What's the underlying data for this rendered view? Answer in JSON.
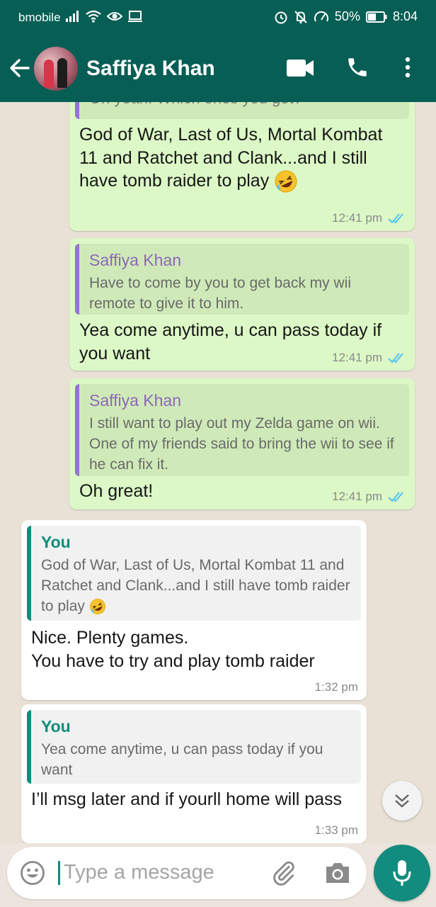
{
  "status_bar": {
    "carrier": "bmobile",
    "battery": "50%",
    "time": "8:04"
  },
  "header": {
    "contact_name": "Saffiya Khan"
  },
  "messages": [
    {
      "direction": "out",
      "partial_quote": "Oh yeah. Which ones you got?",
      "text": "God of War, Last of Us, Mortal Kombat 11 and Ratchet and Clank...and I still have tomb raider to play",
      "emoji": "rolling-on-floor-laughing",
      "time": "12:41 pm",
      "status": "read"
    },
    {
      "direction": "out",
      "quote": {
        "author": "Saffiya Khan",
        "text": "Have to come by you to get back my wii remote to give it to him."
      },
      "text": "Yea come anytime, u can pass today if you want",
      "time": "12:41 pm",
      "status": "read"
    },
    {
      "direction": "out",
      "quote": {
        "author": "Saffiya Khan",
        "text": "I still want to play out my Zelda game on wii. One of my friends said to bring the wii to see if he can fix it."
      },
      "text": "Oh great!",
      "time": "12:41 pm",
      "status": "read"
    },
    {
      "direction": "in",
      "quote": {
        "author": "You",
        "text": "God of War, Last of Us, Mortal Kombat 11 and Ratchet and Clank...and I still have tomb raider to play"
      },
      "text_line1": "Nice. Plenty games.",
      "text_line2": "You have to try and play tomb raider",
      "time": "1:32 pm"
    },
    {
      "direction": "in",
      "quote": {
        "author": "You",
        "text": "Yea come anytime, u can pass today if you want"
      },
      "text": "I’ll msg later and if yourll home will pass",
      "time": "1:33 pm"
    }
  ],
  "composer": {
    "placeholder": "Type a message"
  },
  "colors": {
    "header": "#075e54",
    "accent": "#128c7e",
    "outgoing_bubble": "#dcf8c6",
    "incoming_bubble": "#ffffff",
    "read_ticks": "#4fc3f7"
  }
}
